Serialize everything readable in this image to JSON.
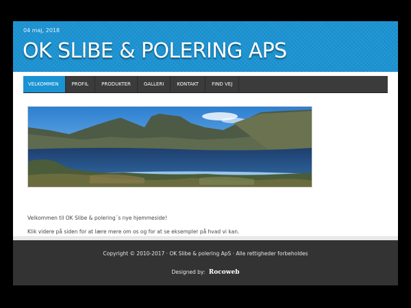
{
  "header": {
    "date": "04 maj, 2018",
    "site_title": "OK SLIBE & POLERING APS"
  },
  "nav": {
    "items": [
      {
        "label": "VELKOMMEN",
        "active": true
      },
      {
        "label": "PROFIL",
        "active": false
      },
      {
        "label": "PRODUKTER",
        "active": false
      },
      {
        "label": "GALLERI",
        "active": false
      },
      {
        "label": "KONTAKT",
        "active": false
      },
      {
        "label": "FIND VEJ",
        "active": false
      }
    ]
  },
  "main": {
    "banner_image": "mountain-lake-panorama",
    "welcome_text": "Velkommen til OK Slibe & polering´s nye hjemmeside!",
    "info_text": "Klik videre på siden for at lære mere om os og for at se eksempler på hvad vi kan."
  },
  "footer": {
    "copyright": "Copyright © 2010-2017 · OK Slibe & polering ApS · Alle rettigheder forbeholdes",
    "designed_by_label": "Designed by:",
    "designer_brand": "Rocoweb"
  },
  "colors": {
    "header_blue": "#1a93d3",
    "nav_dark": "#3b3b3b",
    "footer_dark": "#333333",
    "page_bg": "#000000"
  }
}
